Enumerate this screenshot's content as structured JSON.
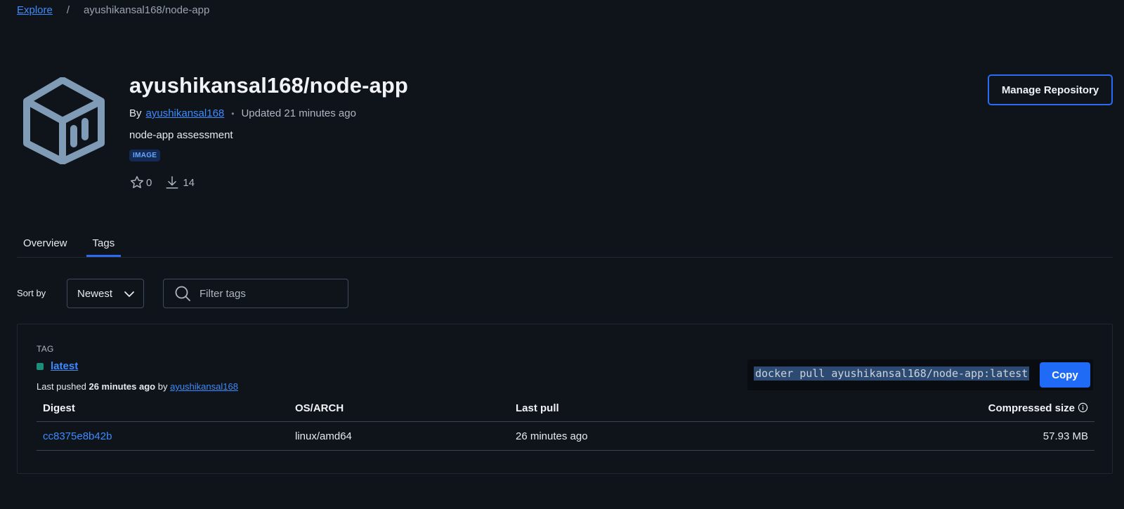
{
  "breadcrumb": {
    "explore": "Explore",
    "separator": "/",
    "current": "ayushikansal168/node-app"
  },
  "header": {
    "title": "ayushikansal168/node-app",
    "by_label": "By",
    "owner": "ayushikansal168",
    "updated": "Updated 21 minutes ago",
    "description": "node-app assessment",
    "badge": "IMAGE",
    "stars": "0",
    "pulls": "14",
    "manage_button": "Manage Repository",
    "icon": "cube-icon"
  },
  "tabs": [
    {
      "label": "Overview",
      "active": false
    },
    {
      "label": "Tags",
      "active": true
    }
  ],
  "controls": {
    "sort_label": "Sort by",
    "sort_value": "Newest",
    "filter_placeholder": "Filter tags"
  },
  "tag": {
    "heading": "TAG",
    "name": "latest",
    "pushed_prefix": "Last pushed",
    "pushed_time": "26 minutes ago",
    "pushed_by_label": "by",
    "pushed_by": "ayushikansal168",
    "pull_command": "docker pull ayushikansal168/node-app:latest",
    "copy_label": "Copy"
  },
  "table": {
    "headers": [
      "Digest",
      "OS/ARCH",
      "Last pull",
      "Compressed size"
    ],
    "rows": [
      {
        "digest": "cc8375e8b42b",
        "os_arch": "linux/amd64",
        "last_pull": "26 minutes ago",
        "size": "57.93 MB"
      }
    ]
  },
  "colors": {
    "background": "#0f141b",
    "accent": "#2a6bf2",
    "link": "#3d8bfd",
    "tag_status": "#1a8f7a"
  }
}
